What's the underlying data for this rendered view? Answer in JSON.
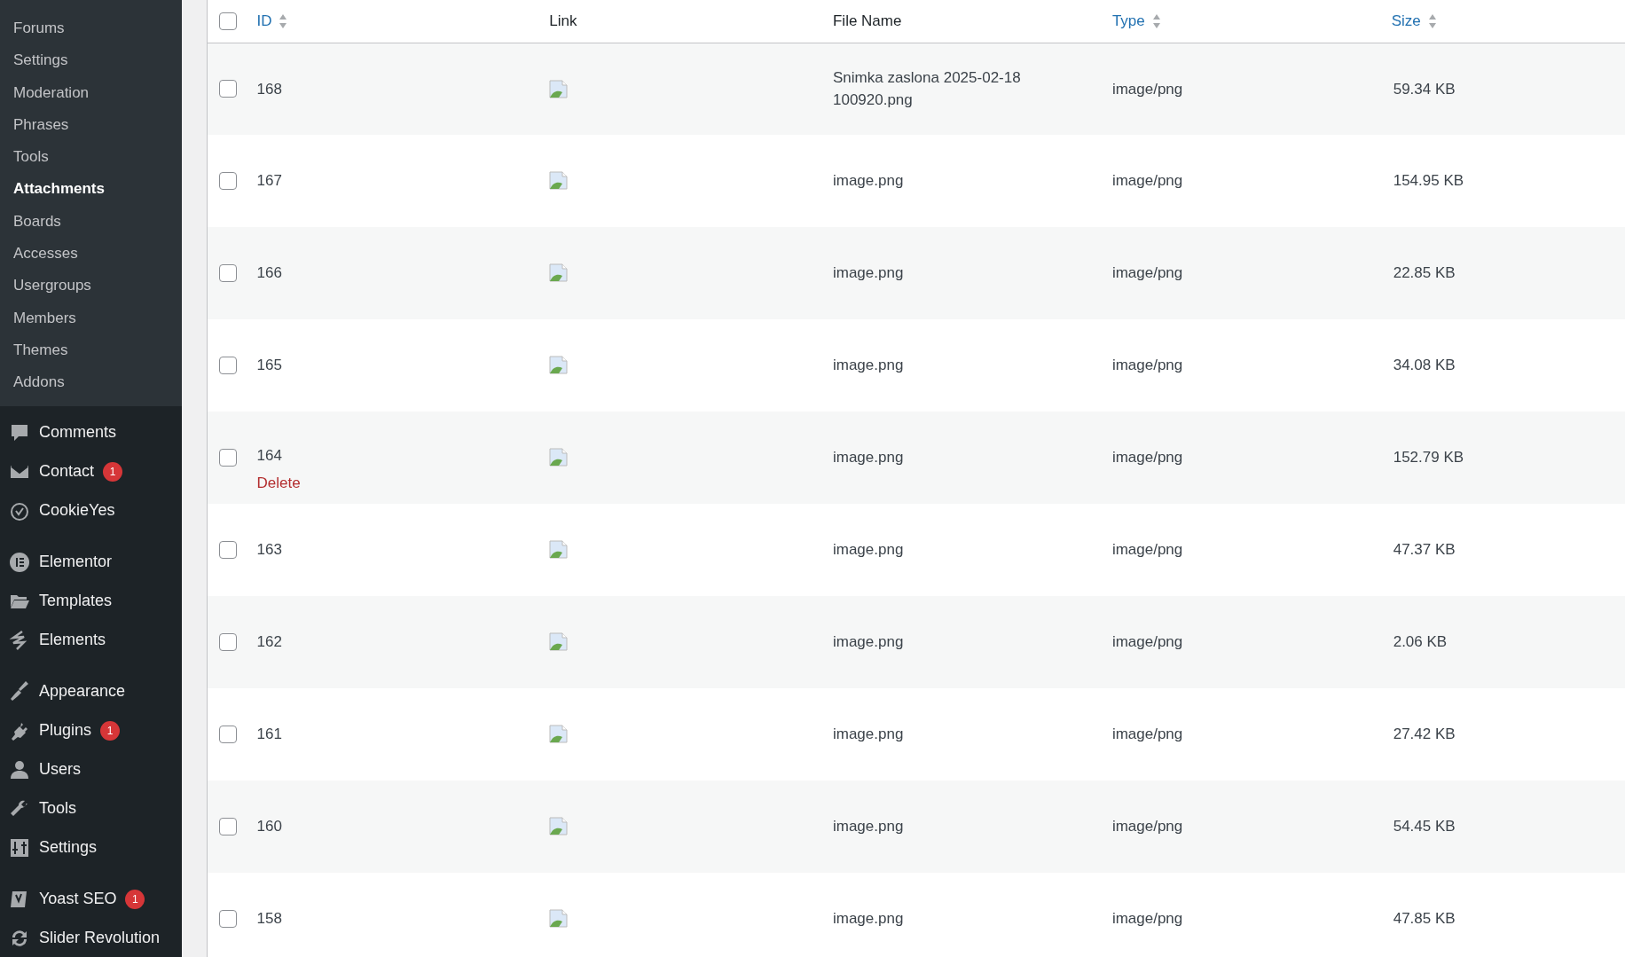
{
  "sidebar": {
    "submenu": [
      {
        "label": "Forums",
        "selected": false
      },
      {
        "label": "Settings",
        "selected": false
      },
      {
        "label": "Moderation",
        "selected": false
      },
      {
        "label": "Phrases",
        "selected": false
      },
      {
        "label": "Tools",
        "selected": false
      },
      {
        "label": "Attachments",
        "selected": true
      },
      {
        "label": "Boards",
        "selected": false
      },
      {
        "label": "Accesses",
        "selected": false
      },
      {
        "label": "Usergroups",
        "selected": false
      },
      {
        "label": "Members",
        "selected": false
      },
      {
        "label": "Themes",
        "selected": false
      },
      {
        "label": "Addons",
        "selected": false
      }
    ],
    "menu_groups": [
      [
        {
          "label": "Comments"
        },
        {
          "label": "Contact",
          "badge": "1"
        },
        {
          "label": "CookieYes"
        }
      ],
      [
        {
          "label": "Elementor"
        },
        {
          "label": "Templates"
        },
        {
          "label": "Elements"
        }
      ],
      [
        {
          "label": "Appearance"
        },
        {
          "label": "Plugins",
          "badge": "1"
        },
        {
          "label": "Users"
        },
        {
          "label": "Tools"
        },
        {
          "label": "Settings"
        }
      ],
      [
        {
          "label": "Yoast SEO",
          "badge": "1"
        },
        {
          "label": "Slider Revolution"
        }
      ]
    ]
  },
  "table": {
    "columns": [
      {
        "label": "ID",
        "sortable": true
      },
      {
        "label": "Link",
        "sortable": false
      },
      {
        "label": "File Name",
        "sortable": false
      },
      {
        "label": "Type",
        "sortable": true
      },
      {
        "label": "Size",
        "sortable": true
      }
    ],
    "header_checked": false,
    "rows": [
      {
        "id": "168",
        "file_name": "Snimka zaslona 2025-02-18 100920.png",
        "type": "image/png",
        "size": "59.34 KB",
        "checked": false
      },
      {
        "id": "167",
        "file_name": "image.png",
        "type": "image/png",
        "size": "154.95 KB",
        "checked": false
      },
      {
        "id": "166",
        "file_name": "image.png",
        "type": "image/png",
        "size": "22.85 KB",
        "checked": false
      },
      {
        "id": "165",
        "file_name": "image.png",
        "type": "image/png",
        "size": "34.08 KB",
        "checked": false
      },
      {
        "id": "164",
        "action": "Delete",
        "file_name": "image.png",
        "type": "image/png",
        "size": "152.79 KB",
        "checked": false
      },
      {
        "id": "163",
        "file_name": "image.png",
        "type": "image/png",
        "size": "47.37 KB",
        "checked": false
      },
      {
        "id": "162",
        "file_name": "image.png",
        "type": "image/png",
        "size": "2.06 KB",
        "checked": false
      },
      {
        "id": "161",
        "file_name": "image.png",
        "type": "image/png",
        "size": "27.42 KB",
        "checked": false
      },
      {
        "id": "160",
        "file_name": "image.png",
        "type": "image/png",
        "size": "54.45 KB",
        "checked": false
      },
      {
        "id": "158",
        "file_name": "image.png",
        "type": "image/png",
        "size": "47.85 KB",
        "checked": false
      }
    ]
  }
}
